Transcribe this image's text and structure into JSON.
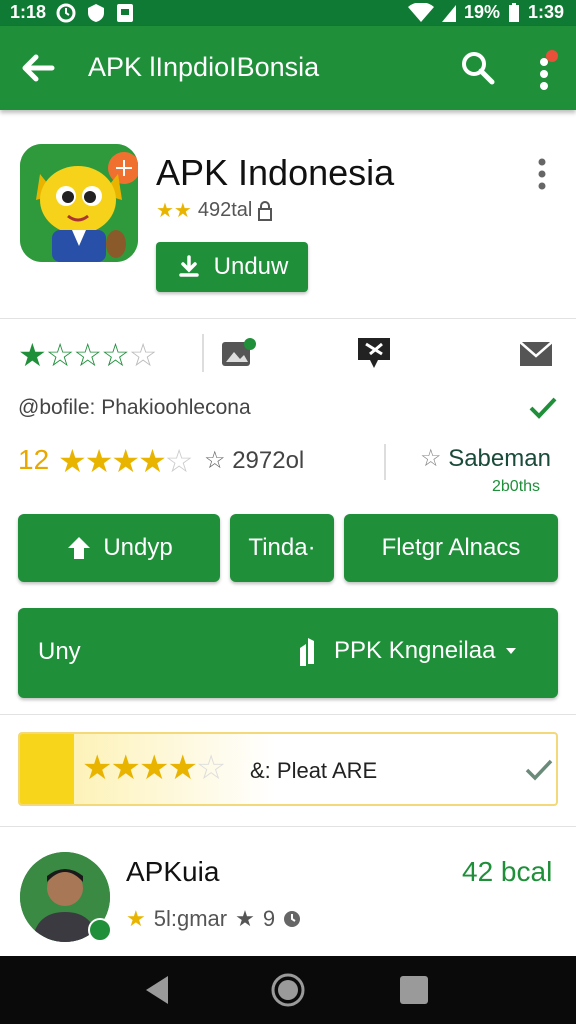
{
  "status_bar": {
    "left_time": "1:18",
    "battery": "19%",
    "time": "1:39"
  },
  "app_bar": {
    "title": "APK lInpdioIBonsia"
  },
  "app": {
    "name": "APK Indonesia",
    "sub_rating_text": "492tal",
    "download_label": "Unduw"
  },
  "info": {
    "package_line": "@bofile: Phakioohlecona",
    "rating_number": "12",
    "rating_count": "2972ol",
    "sab_label": "Sabeman",
    "sab_points": "2b0ths"
  },
  "buttons": {
    "upload": "Undyp",
    "tinda": "Tinda·",
    "fleigr": "Fletgr Alnacs"
  },
  "big_bar": {
    "label": "Uny",
    "package": "PPK Kngneilaa"
  },
  "rate_card": {
    "text": "&: Pleat ARE",
    "stars": 3.5
  },
  "review": {
    "name": "APKuia",
    "subtitle": "5l:gmar",
    "meta": "9",
    "count": "42 bcal"
  },
  "colors": {
    "primary": "#1f8f3a",
    "status": "#0f7a33",
    "star": "#e9b400"
  }
}
